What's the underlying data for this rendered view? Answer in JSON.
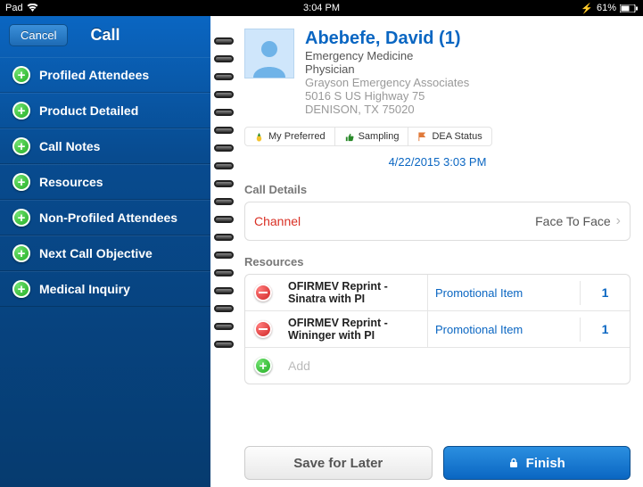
{
  "status_bar": {
    "device": "Pad",
    "time": "3:04 PM",
    "battery": "61%"
  },
  "sidebar": {
    "cancel": "Cancel",
    "title": "Call",
    "items": [
      {
        "label": "Profiled Attendees"
      },
      {
        "label": "Product Detailed"
      },
      {
        "label": "Call Notes"
      },
      {
        "label": "Resources"
      },
      {
        "label": "Non-Profiled Attendees"
      },
      {
        "label": "Next Call Objective"
      },
      {
        "label": "Medical Inquiry"
      }
    ]
  },
  "profile": {
    "name": "Abebefe, David (1)",
    "specialty": "Emergency Medicine",
    "title": "Physician",
    "org": "Grayson Emergency Associates",
    "addr1": "5016 S US Highway 75",
    "addr2": "DENISON, TX 75020"
  },
  "tags": {
    "preferred": "My Preferred",
    "sampling": "Sampling",
    "dea": "DEA Status"
  },
  "timestamp": "4/22/2015 3:03 PM",
  "call_details": {
    "heading": "Call Details",
    "channel_label": "Channel",
    "channel_value": "Face To Face"
  },
  "resources": {
    "heading": "Resources",
    "rows": [
      {
        "name": "OFIRMEV Reprint - Sinatra with PI",
        "type": "Promotional Item",
        "qty": "1"
      },
      {
        "name": "OFIRMEV Reprint - Wininger with PI",
        "type": "Promotional Item",
        "qty": "1"
      }
    ],
    "add": "Add"
  },
  "footer": {
    "save": "Save for Later",
    "finish": "Finish"
  }
}
